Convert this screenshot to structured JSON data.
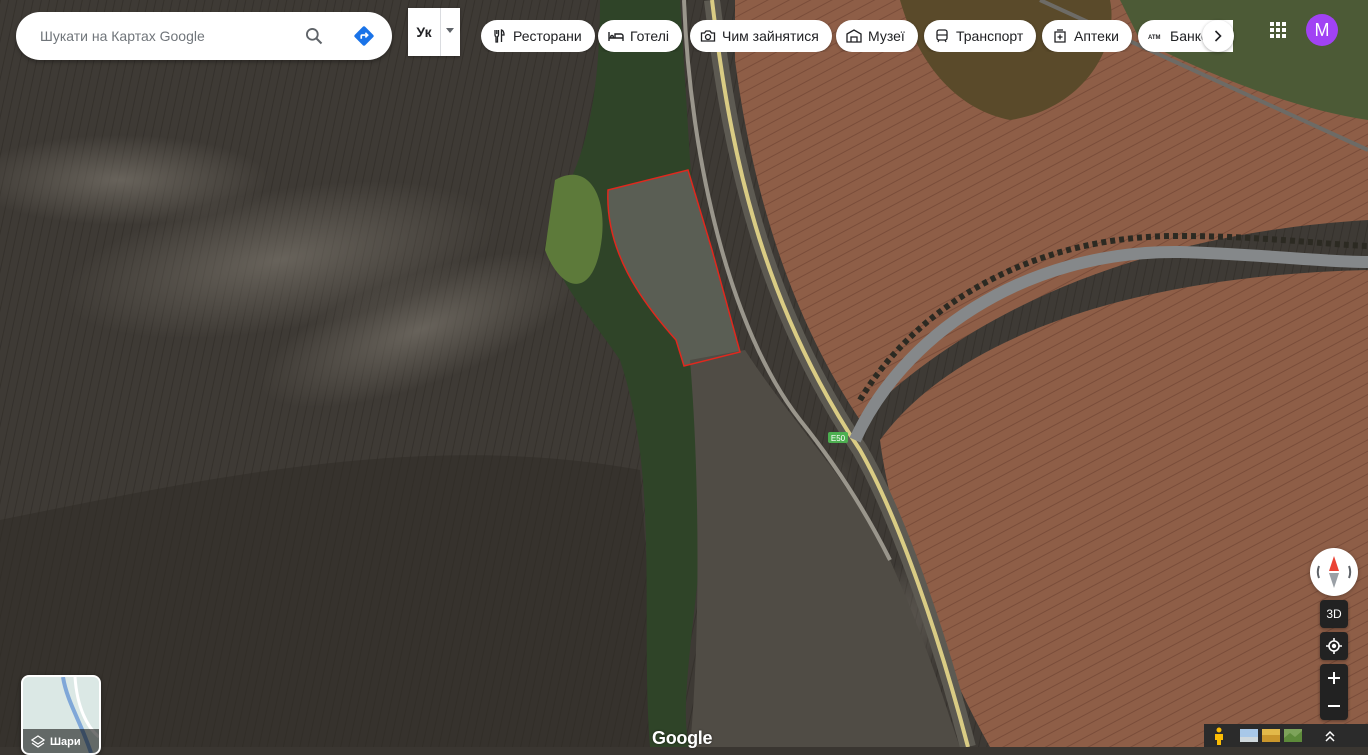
{
  "search": {
    "placeholder": "Шукати на Картах Google"
  },
  "language": {
    "label": "Ук"
  },
  "chips": [
    {
      "label": "Ресторани",
      "icon": "restaurant-icon"
    },
    {
      "label": "Готелі",
      "icon": "hotel-icon"
    },
    {
      "label": "Чим зайнятися",
      "icon": "camera-icon"
    },
    {
      "label": "Музеї",
      "icon": "museum-icon"
    },
    {
      "label": "Транспорт",
      "icon": "transit-icon"
    },
    {
      "label": "Аптеки",
      "icon": "pharmacy-icon"
    },
    {
      "label": "Банкомати",
      "icon": "atm-icon"
    }
  ],
  "account": {
    "initial": "M"
  },
  "controls": {
    "three_d": "3D"
  },
  "layers": {
    "label": "Шари"
  },
  "map": {
    "road_label": "E50",
    "logo": "Google"
  },
  "colors": {
    "accent": "#1a73e8",
    "avatar": "#a142f4",
    "parcel_outline": "#e0281e",
    "road": "#e8d88a",
    "road_shield": "#4caf50"
  }
}
